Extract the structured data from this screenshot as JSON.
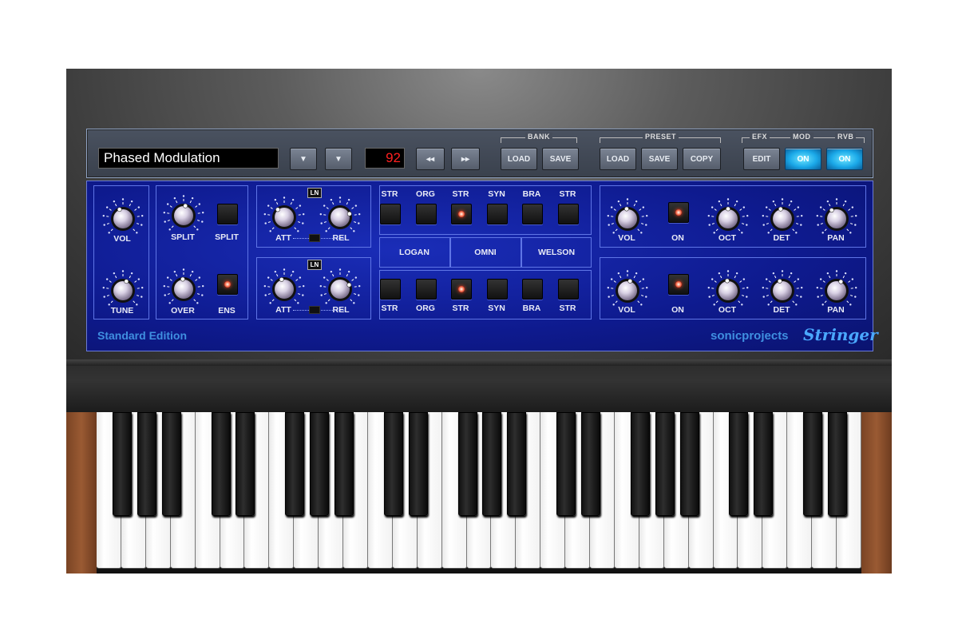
{
  "preset_name": "Phased Modulation",
  "bank_number": "92",
  "toolbar": {
    "bank_label": "BANK",
    "preset_label": "PRESET",
    "efx_label": "EFX",
    "mod_label": "MOD",
    "rvb_label": "RVB",
    "bank_load": "LOAD",
    "bank_save": "SAVE",
    "preset_load": "LOAD",
    "preset_save": "SAVE",
    "preset_copy": "COPY",
    "efx_edit": "EDIT",
    "mod_on": "ON",
    "rvb_on": "ON",
    "down_arrow": "▼",
    "prev": "◂◂",
    "next": "▸▸"
  },
  "left": {
    "vol": "VOL",
    "tune": "TUNE"
  },
  "split": {
    "split_knob": "SPLIT",
    "split_switch": "SPLIT",
    "over": "OVER",
    "ens": "ENS"
  },
  "env_upper": {
    "ln": "LN",
    "att": "ATT",
    "rel": "REL"
  },
  "env_lower": {
    "ln": "LN",
    "att": "ATT",
    "rel": "REL"
  },
  "voices_upper": [
    "STR",
    "ORG",
    "STR",
    "SYN",
    "BRA",
    "STR"
  ],
  "voices_lower": [
    "STR",
    "ORG",
    "STR",
    "SYN",
    "BRA",
    "STR"
  ],
  "voice_active_index": 2,
  "models": [
    "LOGAN",
    "OMNI",
    "WELSON"
  ],
  "out_upper": {
    "vol": "VOL",
    "on": "ON",
    "oct": "OCT",
    "det": "DET",
    "pan": "PAN"
  },
  "out_lower": {
    "vol": "VOL",
    "on": "ON",
    "oct": "OCT",
    "det": "DET",
    "pan": "PAN"
  },
  "edition": "Standard Edition",
  "brand": "sonicprojects",
  "product": "Stringer",
  "colors": {
    "panel_blue": "#0e1a8e",
    "led_red": "#e02a10",
    "on_cyan": "#22b4f0",
    "display_red": "#ff2020"
  }
}
